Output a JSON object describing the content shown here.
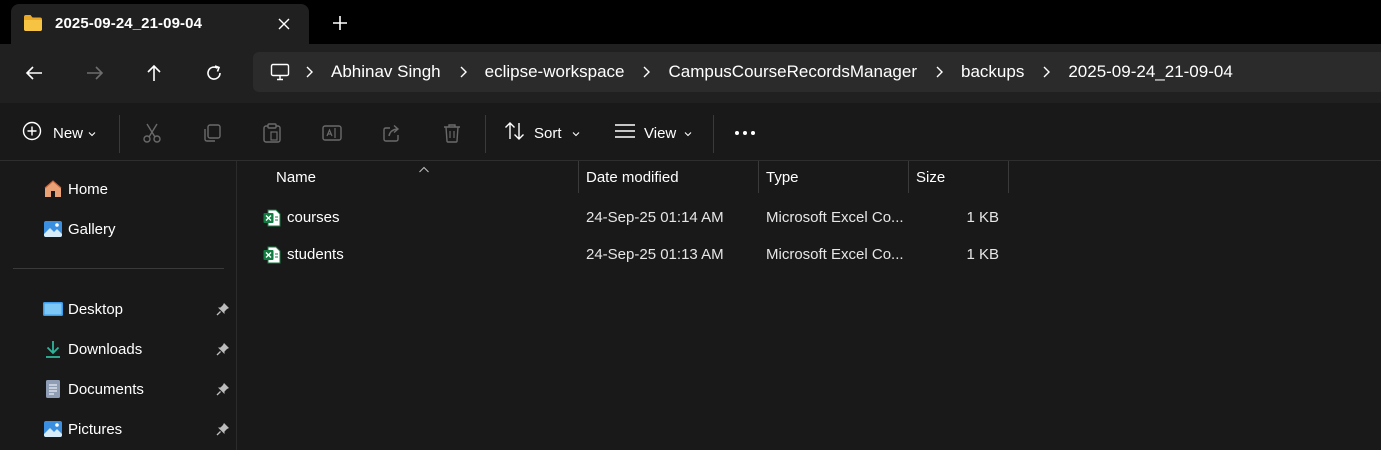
{
  "tab": {
    "title": "2025-09-24_21-09-04",
    "close_icon": "close-icon",
    "new_tab_icon": "plus-icon"
  },
  "nav": {
    "back": "back-arrow-icon",
    "forward": "forward-arrow-icon",
    "up": "up-arrow-icon",
    "refresh": "refresh-icon"
  },
  "breadcrumb": {
    "root_icon": "this-pc-icon",
    "items": [
      "Abhinav Singh",
      "eclipse-workspace",
      "CampusCourseRecordsManager",
      "backups",
      "2025-09-24_21-09-04"
    ]
  },
  "toolbar": {
    "new_label": "New",
    "sort_label": "Sort",
    "view_label": "View",
    "actions": [
      "cut-icon",
      "copy-icon",
      "paste-icon",
      "rename-icon",
      "share-icon",
      "delete-icon"
    ],
    "more_icon": "more-icon"
  },
  "sidebar": {
    "items": [
      {
        "label": "Home",
        "icon": "home-icon",
        "pinned": false
      },
      {
        "label": "Gallery",
        "icon": "gallery-icon",
        "pinned": false
      },
      {
        "label": "Desktop",
        "icon": "desktop-icon",
        "pinned": true
      },
      {
        "label": "Downloads",
        "icon": "downloads-icon",
        "pinned": true
      },
      {
        "label": "Documents",
        "icon": "documents-icon",
        "pinned": true
      },
      {
        "label": "Pictures",
        "icon": "pictures-icon",
        "pinned": true
      }
    ]
  },
  "file_list": {
    "columns": [
      "Name",
      "Date modified",
      "Type",
      "Size"
    ],
    "rows": [
      {
        "name": "courses",
        "date": "24-Sep-25 01:14 AM",
        "type": "Microsoft Excel Co...",
        "size": "1 KB"
      },
      {
        "name": "students",
        "date": "24-Sep-25 01:13 AM",
        "type": "Microsoft Excel Co...",
        "size": "1 KB"
      }
    ]
  },
  "colors": {
    "accent_folder": "#f4c244",
    "excel_green": "#107c41",
    "background": "#191919"
  }
}
